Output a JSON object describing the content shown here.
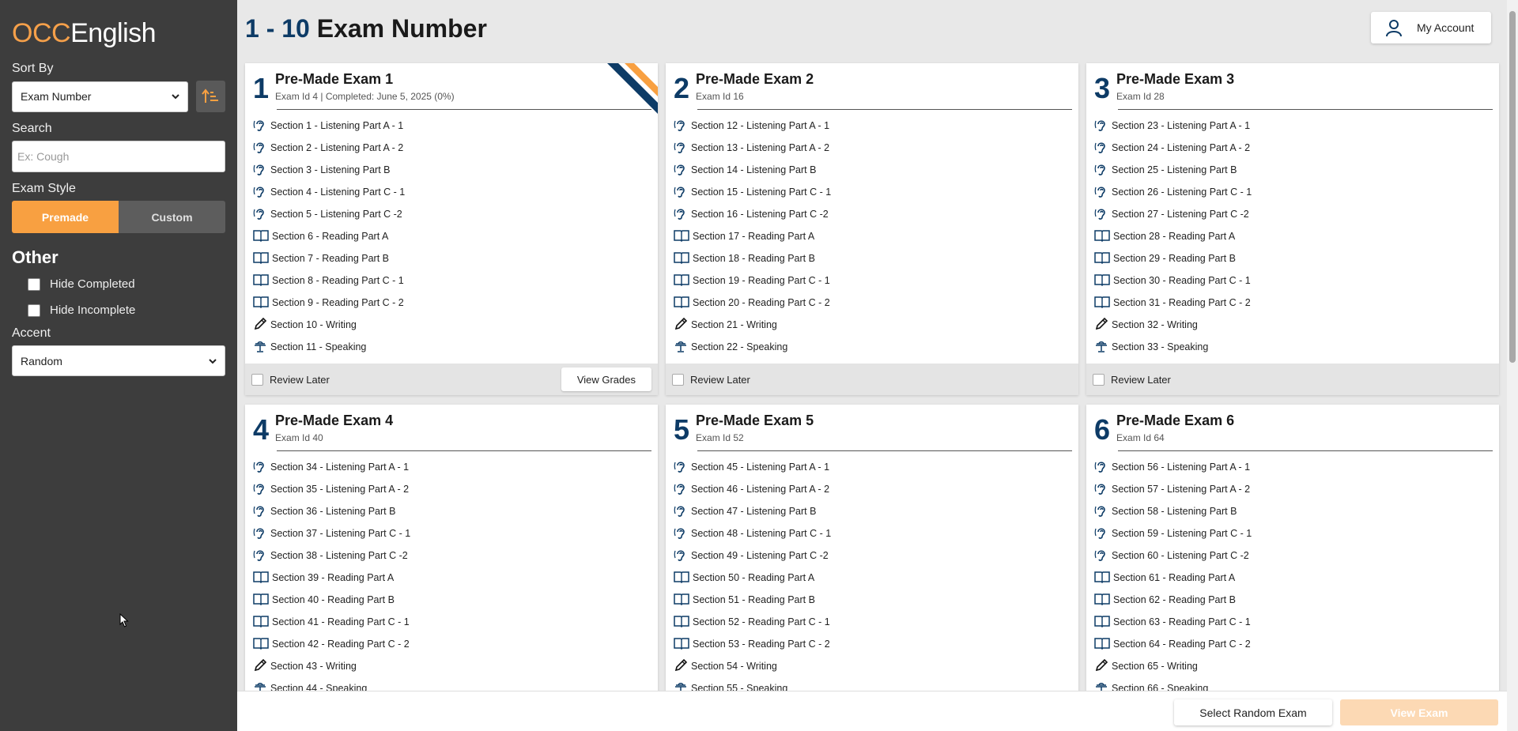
{
  "brand": {
    "part1": "OCC",
    "part2": "English"
  },
  "sidebar": {
    "sort_label": "Sort By",
    "sort_value": "Exam Number",
    "search_label": "Search",
    "search_placeholder": "Ex: Cough",
    "style_label": "Exam Style",
    "style_premade": "Premade",
    "style_custom": "Custom",
    "other_title": "Other",
    "hide_completed": "Hide Completed",
    "hide_incomplete": "Hide Incomplete",
    "accent_label": "Accent",
    "accent_value": "Random"
  },
  "header": {
    "range": "1 - 10",
    "title": "Exam Number",
    "account_label": "My Account"
  },
  "colors": {
    "accent": "#f8a041",
    "navy": "#0d3b66",
    "sidebar": "#3d3d3d"
  },
  "cards": [
    {
      "num": "1",
      "title": "Pre-Made Exam 1",
      "sub": "Exam Id 4 | Completed: June 5, 2025 (0%)",
      "review": "Review Later",
      "grades": "View Grades",
      "sections": [
        {
          "icon": "ear-icon",
          "label": "Section 1 - Listening Part A - 1"
        },
        {
          "icon": "ear-icon",
          "label": "Section 2 - Listening Part A - 2"
        },
        {
          "icon": "ear-icon",
          "label": "Section 3 - Listening Part B"
        },
        {
          "icon": "ear-icon",
          "label": "Section 4 - Listening Part C - 1"
        },
        {
          "icon": "ear-icon",
          "label": "Section 5 - Listening Part C -2"
        },
        {
          "icon": "book-icon",
          "label": "Section 6 - Reading Part A"
        },
        {
          "icon": "book-icon",
          "label": "Section 7 - Reading Part B"
        },
        {
          "icon": "book-icon",
          "label": "Section 8 - Reading Part C - 1"
        },
        {
          "icon": "book-icon",
          "label": "Section 9 - Reading Part C - 2"
        },
        {
          "icon": "pencil-icon",
          "label": "Section 10 - Writing"
        },
        {
          "icon": "podium-icon",
          "label": "Section 11 - Speaking"
        }
      ]
    },
    {
      "num": "2",
      "title": "Pre-Made Exam 2",
      "sub": "Exam Id 16",
      "review": "Review Later",
      "sections": [
        {
          "icon": "ear-icon",
          "label": "Section 12 - Listening Part A - 1"
        },
        {
          "icon": "ear-icon",
          "label": "Section 13 - Listening Part A - 2"
        },
        {
          "icon": "ear-icon",
          "label": "Section 14 - Listening Part B"
        },
        {
          "icon": "ear-icon",
          "label": "Section 15 - Listening Part C - 1"
        },
        {
          "icon": "ear-icon",
          "label": "Section 16 - Listening Part C -2"
        },
        {
          "icon": "book-icon",
          "label": "Section 17 - Reading Part A"
        },
        {
          "icon": "book-icon",
          "label": "Section 18 - Reading Part B"
        },
        {
          "icon": "book-icon",
          "label": "Section 19 - Reading Part C - 1"
        },
        {
          "icon": "book-icon",
          "label": "Section 20 - Reading Part C - 2"
        },
        {
          "icon": "pencil-icon",
          "label": "Section 21 - Writing"
        },
        {
          "icon": "podium-icon",
          "label": "Section 22 - Speaking"
        }
      ]
    },
    {
      "num": "3",
      "title": "Pre-Made Exam 3",
      "sub": "Exam Id 28",
      "review": "Review Later",
      "sections": [
        {
          "icon": "ear-icon",
          "label": "Section 23 - Listening Part A - 1"
        },
        {
          "icon": "ear-icon",
          "label": "Section 24 - Listening Part A - 2"
        },
        {
          "icon": "ear-icon",
          "label": "Section 25 - Listening Part B"
        },
        {
          "icon": "ear-icon",
          "label": "Section 26 - Listening Part C - 1"
        },
        {
          "icon": "ear-icon",
          "label": "Section 27 - Listening Part C -2"
        },
        {
          "icon": "book-icon",
          "label": "Section 28 - Reading Part A"
        },
        {
          "icon": "book-icon",
          "label": "Section 29 - Reading Part B"
        },
        {
          "icon": "book-icon",
          "label": "Section 30 - Reading Part C - 1"
        },
        {
          "icon": "book-icon",
          "label": "Section 31 - Reading Part C - 2"
        },
        {
          "icon": "pencil-icon",
          "label": "Section 32 - Writing"
        },
        {
          "icon": "podium-icon",
          "label": "Section 33 - Speaking"
        }
      ]
    },
    {
      "num": "4",
      "title": "Pre-Made Exam 4",
      "sub": "Exam Id 40",
      "sections": [
        {
          "icon": "ear-icon",
          "label": "Section 34 - Listening Part A - 1"
        },
        {
          "icon": "ear-icon",
          "label": "Section 35 - Listening Part A - 2"
        },
        {
          "icon": "ear-icon",
          "label": "Section 36 - Listening Part B"
        },
        {
          "icon": "ear-icon",
          "label": "Section 37 - Listening Part C - 1"
        },
        {
          "icon": "ear-icon",
          "label": "Section 38 - Listening Part C -2"
        },
        {
          "icon": "book-icon",
          "label": "Section 39 - Reading Part A"
        },
        {
          "icon": "book-icon",
          "label": "Section 40 - Reading Part B"
        },
        {
          "icon": "book-icon",
          "label": "Section 41 - Reading Part C - 1"
        },
        {
          "icon": "book-icon",
          "label": "Section 42 - Reading Part C - 2"
        },
        {
          "icon": "pencil-icon",
          "label": "Section 43 - Writing"
        },
        {
          "icon": "podium-icon",
          "label": "Section 44 - Speaking"
        }
      ]
    },
    {
      "num": "5",
      "title": "Pre-Made Exam 5",
      "sub": "Exam Id 52",
      "sections": [
        {
          "icon": "ear-icon",
          "label": "Section 45 - Listening Part A - 1"
        },
        {
          "icon": "ear-icon",
          "label": "Section 46 - Listening Part A - 2"
        },
        {
          "icon": "ear-icon",
          "label": "Section 47 - Listening Part B"
        },
        {
          "icon": "ear-icon",
          "label": "Section 48 - Listening Part C - 1"
        },
        {
          "icon": "ear-icon",
          "label": "Section 49 - Listening Part C -2"
        },
        {
          "icon": "book-icon",
          "label": "Section 50 - Reading Part A"
        },
        {
          "icon": "book-icon",
          "label": "Section 51 - Reading Part B"
        },
        {
          "icon": "book-icon",
          "label": "Section 52 - Reading Part C - 1"
        },
        {
          "icon": "book-icon",
          "label": "Section 53 - Reading Part C - 2"
        },
        {
          "icon": "pencil-icon",
          "label": "Section 54 - Writing"
        },
        {
          "icon": "podium-icon",
          "label": "Section 55 - Speaking"
        }
      ]
    },
    {
      "num": "6",
      "title": "Pre-Made Exam 6",
      "sub": "Exam Id 64",
      "sections": [
        {
          "icon": "ear-icon",
          "label": "Section 56 - Listening Part A - 1"
        },
        {
          "icon": "ear-icon",
          "label": "Section 57 - Listening Part A - 2"
        },
        {
          "icon": "ear-icon",
          "label": "Section 58 - Listening Part B"
        },
        {
          "icon": "ear-icon",
          "label": "Section 59 - Listening Part C - 1"
        },
        {
          "icon": "ear-icon",
          "label": "Section 60 - Listening Part C -2"
        },
        {
          "icon": "book-icon",
          "label": "Section 61 - Reading Part A"
        },
        {
          "icon": "book-icon",
          "label": "Section 62 - Reading Part B"
        },
        {
          "icon": "book-icon",
          "label": "Section 63 - Reading Part C - 1"
        },
        {
          "icon": "book-icon",
          "label": "Section 64 - Reading Part C - 2"
        },
        {
          "icon": "pencil-icon",
          "label": "Section 65 - Writing"
        },
        {
          "icon": "podium-icon",
          "label": "Section 66 - Speaking"
        }
      ]
    }
  ],
  "footer": {
    "random_label": "Select Random Exam",
    "view_label": "View Exam"
  }
}
